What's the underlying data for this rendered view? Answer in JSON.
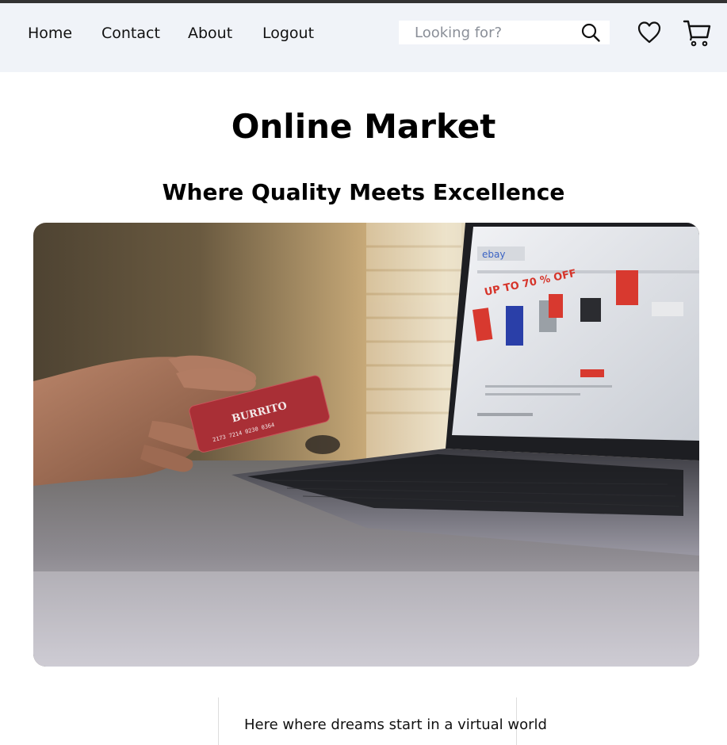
{
  "nav": {
    "links": [
      "Home",
      "Contact",
      "About",
      "Logout"
    ]
  },
  "search": {
    "placeholder": "Looking for?"
  },
  "icons": {
    "search": "search-icon",
    "wishlist": "heart-icon",
    "cart": "cart-icon"
  },
  "main": {
    "title": "Online Market",
    "subtitle": "Where Quality Meets Excellence",
    "bottom_text": "Here where dreams start in a virtual world"
  },
  "colors": {
    "navbar_bg": "#f0f3f8",
    "card_red": "#b42b34"
  }
}
